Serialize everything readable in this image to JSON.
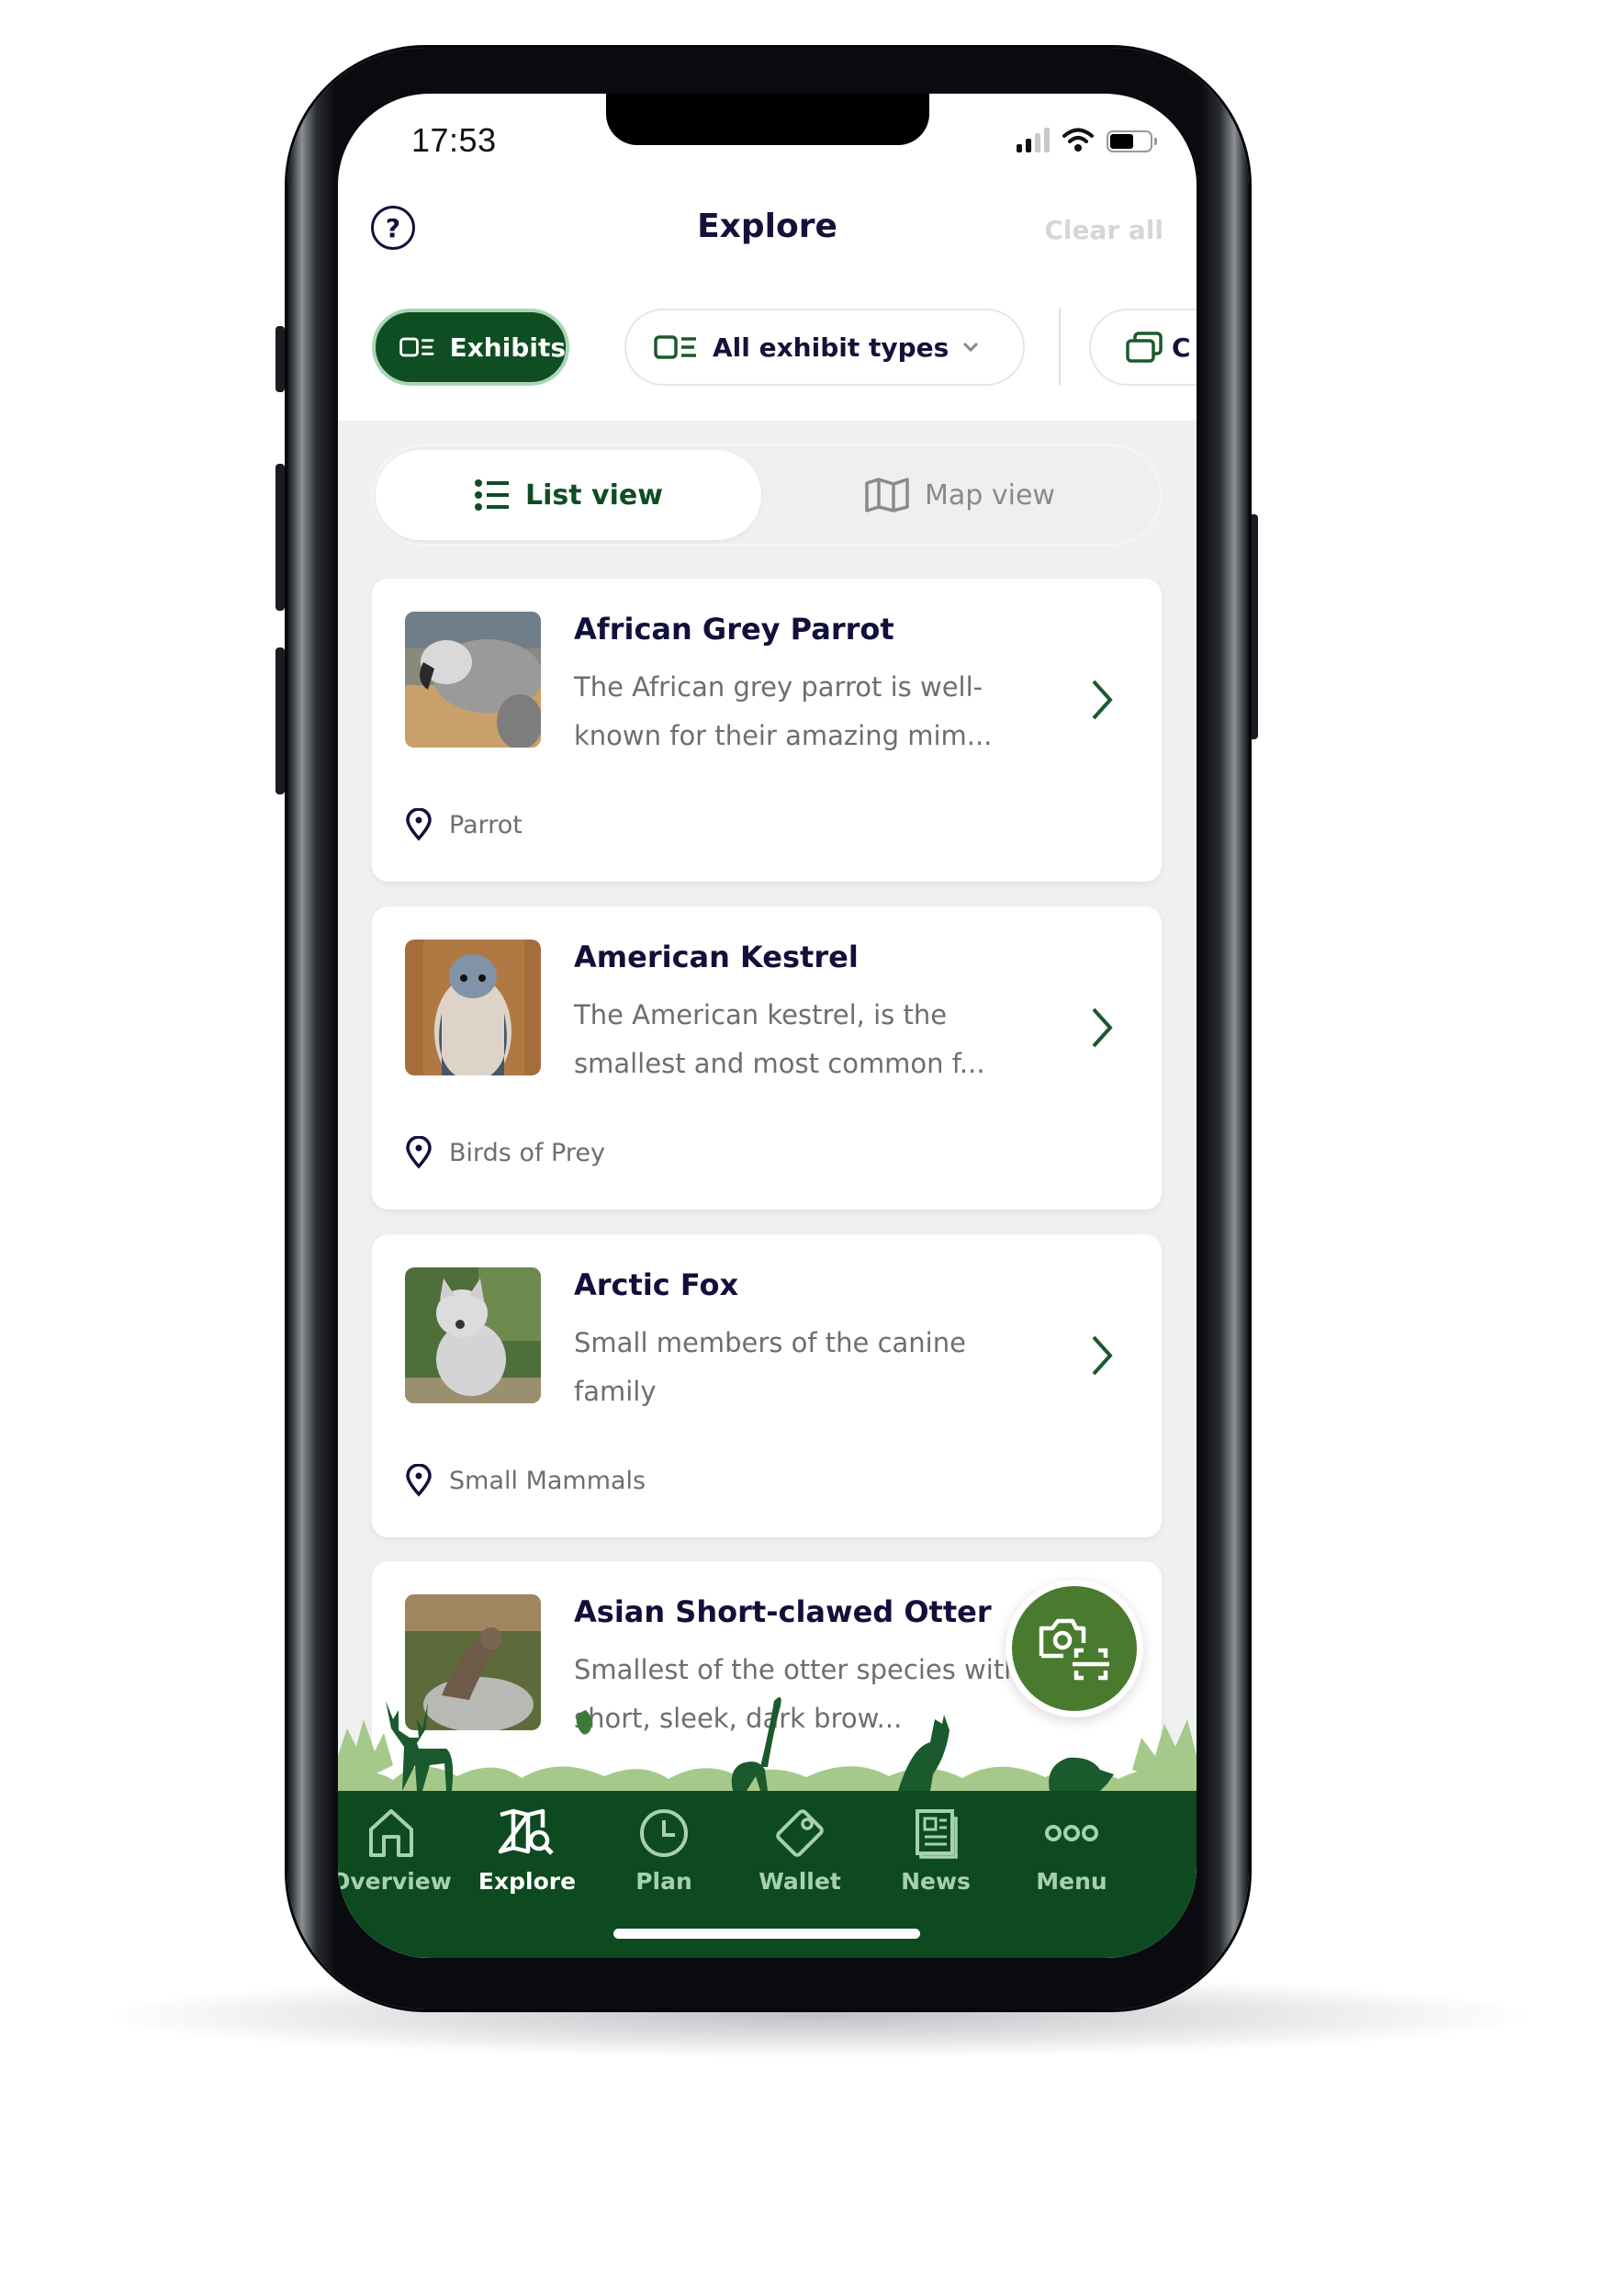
{
  "status_bar": {
    "time": "17:53",
    "signal_bars": 2,
    "signal_total": 4,
    "battery_percent": 60
  },
  "header": {
    "title": "Explore",
    "clear_label": "Clear all",
    "help_icon": "question-circle-icon"
  },
  "filters": {
    "chips": [
      {
        "label": "Exhibits",
        "icon": "exhibits-icon",
        "selected": true
      },
      {
        "label": "All exhibit types",
        "icon": "exhibits-icon",
        "dropdown": true,
        "selected": false
      },
      {
        "label": "C",
        "icon": "collections-icon",
        "selected": false
      }
    ]
  },
  "view_toggle": {
    "list_label": "List view",
    "map_label": "Map view",
    "active": "list"
  },
  "exhibits": [
    {
      "title": "African Grey Parrot",
      "description": "The African grey parrot is well-known for their amazing mim...",
      "location": "Parrot"
    },
    {
      "title": "American Kestrel",
      "description": "The American kestrel, is the smallest and most common f...",
      "location": "Birds of Prey"
    },
    {
      "title": "Arctic Fox",
      "description": "Small members of the canine family",
      "location": "Small Mammals"
    },
    {
      "title": "Asian Short-clawed Otter",
      "description": "Smallest of the otter species with a short, sleek, dark brow...",
      "location": ""
    }
  ],
  "fab": {
    "icon": "camera-scan-icon"
  },
  "bottom_nav": {
    "active": "Explore",
    "items": [
      {
        "label": "Overview",
        "icon": "home-icon"
      },
      {
        "label": "Explore",
        "icon": "map-search-icon"
      },
      {
        "label": "Plan",
        "icon": "clock-icon"
      },
      {
        "label": "Wallet",
        "icon": "wallet-icon"
      },
      {
        "label": "News",
        "icon": "newspaper-icon"
      },
      {
        "label": "Menu",
        "icon": "more-icon"
      }
    ]
  },
  "colors": {
    "primary": "#0f4d22",
    "nav_bg": "#0d4a20",
    "fab": "#4a7a2e",
    "title": "#12103a",
    "muted": "#6e6e6e",
    "nav_inactive": "#a7d1ae"
  }
}
